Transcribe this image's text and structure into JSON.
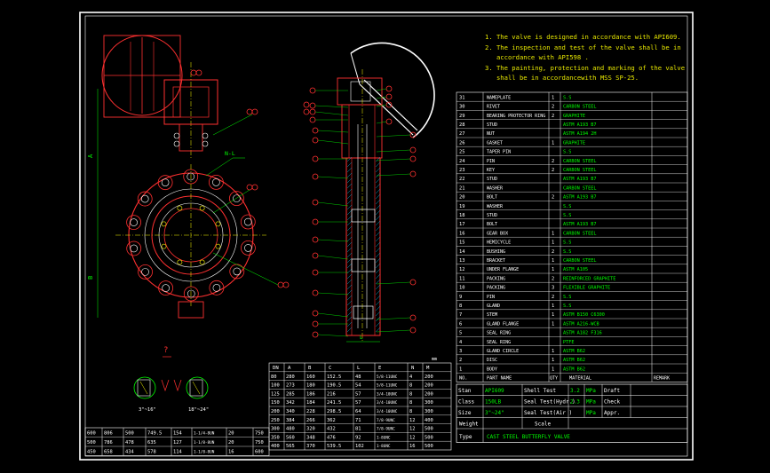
{
  "notes": [
    "1. The valve is designed in accordance with API609.",
    "2. The inspection and test of the valve shall be in",
    "   accordance with API598 .",
    "3. The painting, protection and marking of the valve",
    "   shall be in accordancewith MSS SP-25."
  ],
  "detail_marker": "?",
  "detail_labels": [
    "3\"~16\"",
    "18\"~24\""
  ],
  "dim_labels": {
    "height_upper": "A",
    "height_lower": "B",
    "callout": "N-L",
    "mm": "mm",
    "bottom": "L"
  },
  "parts": [
    {
      "no": "31",
      "name": "NAMEPLATE",
      "qty": "1",
      "material": "S.S"
    },
    {
      "no": "30",
      "name": "RIVET",
      "qty": "2",
      "material": "CARBON STEEL"
    },
    {
      "no": "29",
      "name": "BEARING PROTECTOR RING",
      "qty": "2",
      "material": "GRAPHITE"
    },
    {
      "no": "28",
      "name": "STUD",
      "qty": "",
      "material": "ASTM A193 B7"
    },
    {
      "no": "27",
      "name": "NUT",
      "qty": "",
      "material": "ASTM A194 2H"
    },
    {
      "no": "26",
      "name": "GASKET",
      "qty": "1",
      "material": "GRAPHITE"
    },
    {
      "no": "25",
      "name": "TAPER PIN",
      "qty": "",
      "material": "S.S"
    },
    {
      "no": "24",
      "name": "PIN",
      "qty": "2",
      "material": "CARBON STEEL"
    },
    {
      "no": "23",
      "name": "KEY",
      "qty": "2",
      "material": "CARBON STEEL"
    },
    {
      "no": "22",
      "name": "STUD",
      "qty": "",
      "material": "ASTM A193 B7"
    },
    {
      "no": "21",
      "name": "WASHER",
      "qty": "",
      "material": "CARBON STEEL"
    },
    {
      "no": "20",
      "name": "BOLT",
      "qty": "2",
      "material": "ASTM A193 B7"
    },
    {
      "no": "19",
      "name": "WASHER",
      "qty": "",
      "material": "S.S"
    },
    {
      "no": "18",
      "name": "STUD",
      "qty": "",
      "material": "S.S"
    },
    {
      "no": "17",
      "name": "BOLT",
      "qty": "",
      "material": "ASTM A193 B7"
    },
    {
      "no": "16",
      "name": "GEAR BOX",
      "qty": "1",
      "material": "CARBON STEEL"
    },
    {
      "no": "15",
      "name": "HEMICYCLE",
      "qty": "1",
      "material": "S.S"
    },
    {
      "no": "14",
      "name": "BUSHING",
      "qty": "2",
      "material": "S.S"
    },
    {
      "no": "13",
      "name": "BRACKET",
      "qty": "1",
      "material": "CARBON STEEL"
    },
    {
      "no": "12",
      "name": "UNDER FLANGE",
      "qty": "1",
      "material": "ASTM A105"
    },
    {
      "no": "11",
      "name": "PACKING",
      "qty": "2",
      "material": "REINFORCED GRAPHITE"
    },
    {
      "no": "10",
      "name": "PACKING",
      "qty": "3",
      "material": "FLEXIBLE GRAPHITE"
    },
    {
      "no": "9",
      "name": "PIN",
      "qty": "2",
      "material": "S.S"
    },
    {
      "no": "8",
      "name": "GLAND",
      "qty": "1",
      "material": "S.S"
    },
    {
      "no": "7",
      "name": "STEM",
      "qty": "1",
      "material": "ASTM B150 C6300"
    },
    {
      "no": "6",
      "name": "GLAND FLANGE",
      "qty": "1",
      "material": "ASTM A216-WCB"
    },
    {
      "no": "5",
      "name": "SEAL RING",
      "qty": "",
      "material": "ASTM A182 F316"
    },
    {
      "no": "4",
      "name": "SEAL RING",
      "qty": "",
      "material": "PTFE"
    },
    {
      "no": "3",
      "name": "GLAND CIRCLE",
      "qty": "1",
      "material": "ASTM B62"
    },
    {
      "no": "2",
      "name": "DISC",
      "qty": "1",
      "material": "ASTM B62"
    },
    {
      "no": "1",
      "name": "BODY",
      "qty": "1",
      "material": "ASTM B62"
    }
  ],
  "parts_header": {
    "no": "NO.",
    "name": "PART NAME",
    "qty": "QTY",
    "material": "MATERIAL",
    "remark": "REMARK"
  },
  "title_block": {
    "r1": [
      "Stan",
      "API609",
      "Shell Test",
      "3.2",
      "MPa",
      "Draft",
      ""
    ],
    "r2": [
      "Class",
      "150LB",
      "Seal Test(Hydr.)",
      "2.3",
      "MPa",
      "Check",
      ""
    ],
    "r3": [
      "Size",
      "3\"~24\"",
      "Seal Test(Air )",
      "",
      "MPa",
      "Appr.",
      ""
    ],
    "r4": [
      "Weight",
      "",
      "Scale",
      "",
      ""
    ],
    "type_label": "Type",
    "type_value": "CAST STEEL BUTTERFLY VALVE"
  },
  "dim_table": {
    "headers": [
      "DN",
      "A",
      "B",
      "C",
      "L",
      "E",
      "N",
      "M"
    ],
    "rows": [
      [
        "80",
        "280",
        "160",
        "152.5",
        "48",
        "5/8-11UNC",
        "4",
        "200"
      ],
      [
        "100",
        "273",
        "180",
        "190.5",
        "54",
        "5/8-11UNC",
        "8",
        "200"
      ],
      [
        "125",
        "285",
        "186",
        "216",
        "57",
        "3/4-10UNC",
        "8",
        "200"
      ],
      [
        "150",
        "342",
        "184",
        "241.5",
        "57",
        "3/4-10UNC",
        "8",
        "300"
      ],
      [
        "200",
        "340",
        "228",
        "298.5",
        "64",
        "3/4-10UNC",
        "8",
        "300"
      ],
      [
        "250",
        "384",
        "266",
        "362",
        "71",
        "7/8-9UNC",
        "12",
        "400"
      ],
      [
        "300",
        "480",
        "320",
        "432",
        "81",
        "7/8-9UNC",
        "12",
        "500"
      ],
      [
        "350",
        "560",
        "348",
        "476",
        "92",
        "1-8UNC",
        "12",
        "500"
      ],
      [
        "400",
        "565",
        "370",
        "539.5",
        "102",
        "1-8UNC",
        "16",
        "500"
      ]
    ]
  },
  "dim_table_low": {
    "rows": [
      [
        "600",
        "806",
        "500",
        "749.5",
        "154",
        "1-1/4-8UN",
        "20",
        "750"
      ],
      [
        "500",
        "786",
        "478",
        "635",
        "127",
        "1-1/8-8UN",
        "20",
        "750"
      ],
      [
        "450",
        "658",
        "434",
        "578",
        "114",
        "1-1/8-8UN",
        "16",
        "600"
      ]
    ]
  }
}
